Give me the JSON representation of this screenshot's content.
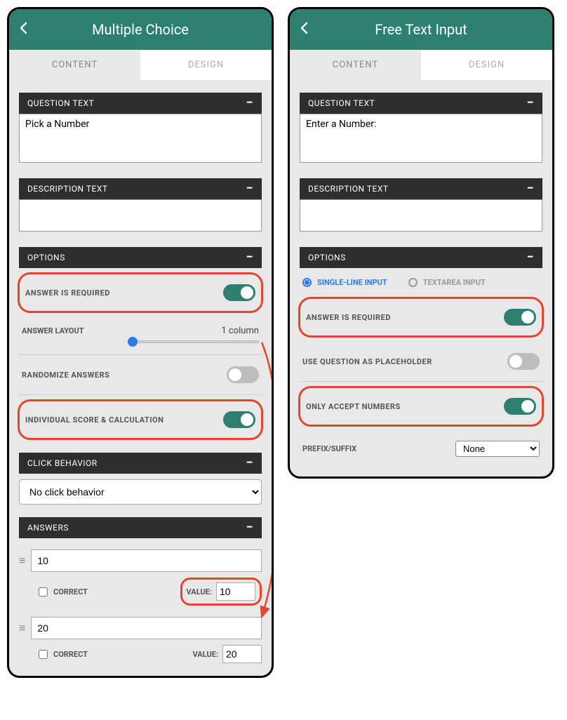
{
  "panels": {
    "left": {
      "title": "Multiple Choice",
      "tabs": {
        "content": "CONTENT",
        "design": "DESIGN"
      },
      "sections": {
        "question_text": {
          "label": "QUESTION TEXT",
          "value": "Pick a Number"
        },
        "description_text": {
          "label": "DESCRIPTION TEXT",
          "value": ""
        },
        "options": {
          "label": "OPTIONS",
          "answer_required": {
            "label": "ANSWER IS REQUIRED",
            "on": true
          },
          "answer_layout": {
            "label": "ANSWER LAYOUT",
            "value_label": "1 column"
          },
          "randomize": {
            "label": "RANDOMIZE ANSWERS",
            "on": false
          },
          "individual_score": {
            "label": "INDIVIDUAL SCORE & CALCULATION",
            "on": true
          }
        },
        "click_behavior": {
          "label": "CLICK BEHAVIOR",
          "value": "No click behavior"
        },
        "answers": {
          "label": "ANSWERS",
          "correct_label": "CORRECT",
          "value_label": "VALUE:",
          "items": [
            {
              "text": "10",
              "correct": false,
              "value": "10"
            },
            {
              "text": "20",
              "correct": false,
              "value": "20"
            }
          ]
        }
      }
    },
    "right": {
      "title": "Free Text Input",
      "tabs": {
        "content": "CONTENT",
        "design": "DESIGN"
      },
      "sections": {
        "question_text": {
          "label": "QUESTION TEXT",
          "value": "Enter a Number:"
        },
        "description_text": {
          "label": "DESCRIPTION TEXT",
          "value": ""
        },
        "options": {
          "label": "OPTIONS",
          "input_type": {
            "single": "SINGLE-LINE INPUT",
            "textarea": "TEXTAREA INPUT",
            "selected": "single"
          },
          "answer_required": {
            "label": "ANSWER IS REQUIRED",
            "on": true
          },
          "placeholder": {
            "label": "USE QUESTION AS PLACEHOLDER",
            "on": false
          },
          "only_numbers": {
            "label": "ONLY ACCEPT NUMBERS",
            "on": true
          },
          "prefix_suffix": {
            "label": "PREFIX/SUFFIX",
            "value": "None"
          }
        }
      }
    }
  }
}
